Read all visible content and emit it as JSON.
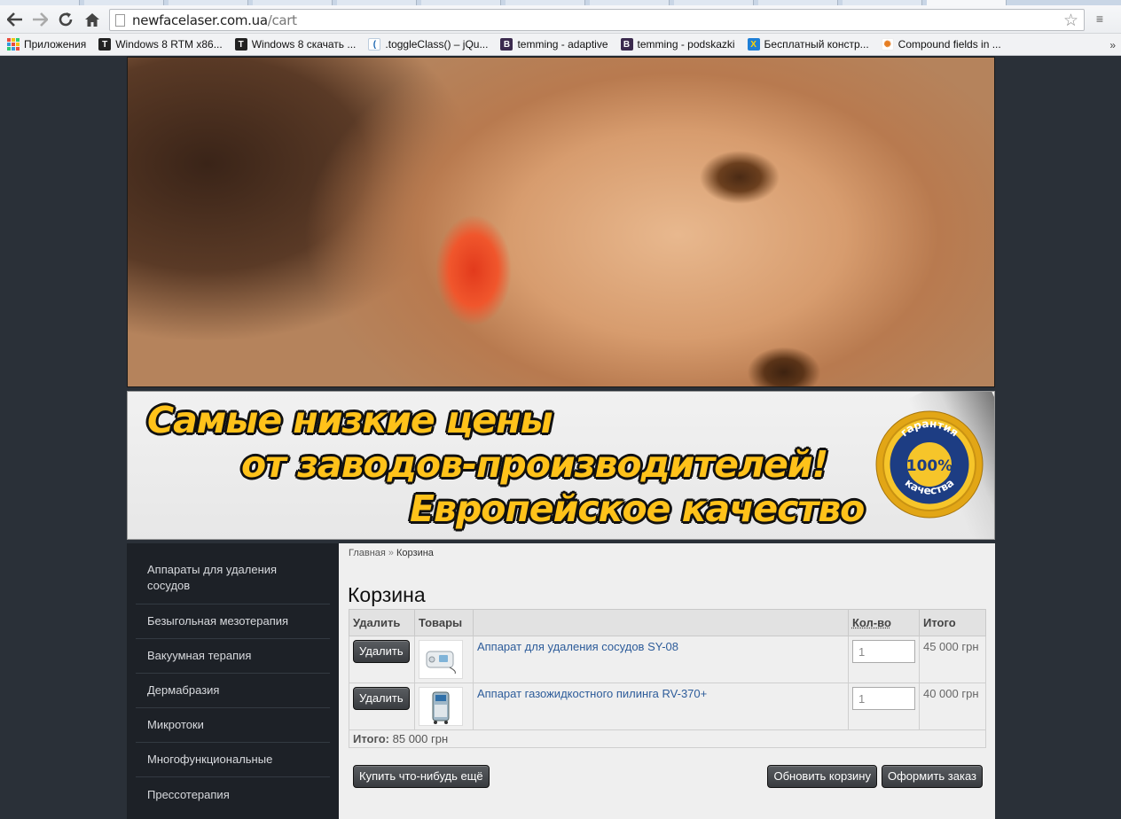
{
  "browser": {
    "url_host": "newfacelaser.com.ua",
    "url_path": "/cart",
    "bookmarks": [
      {
        "label": "Приложения",
        "icon": "apps-grid-icon"
      },
      {
        "label": "Windows 8 RTM x86...",
        "icon": "t-site-icon"
      },
      {
        "label": "Windows 8 скачать ...",
        "icon": "t-site-icon"
      },
      {
        "label": ".toggleClass() – jQu...",
        "icon": "jquery-icon"
      },
      {
        "label": "temming - adaptive",
        "icon": "bootstrap-icon"
      },
      {
        "label": "temming - podskazki",
        "icon": "bootstrap-icon"
      },
      {
        "label": "Бесплатный констр...",
        "icon": "x-site-icon"
      },
      {
        "label": "Compound fields in ...",
        "icon": "drupal-icon"
      }
    ]
  },
  "banner": {
    "line1": "Самые низкие цены",
    "line2": "от заводов-производителей!",
    "line3": "Европейское качество",
    "seal_top": "гарантия",
    "seal_center": "100%",
    "seal_bottom": "качества"
  },
  "sidebar": {
    "items": [
      "Аппараты для удаления сосудов",
      "Безыгольная мезотерапия",
      "Вакуумная терапия",
      "Дермабразия",
      "Микротоки",
      "Многофункциональные",
      "Прессотерапия"
    ]
  },
  "breadcrumb": {
    "home": "Главная",
    "separator": "»",
    "current": "Корзина"
  },
  "cart": {
    "title": "Корзина",
    "columns": {
      "remove": "Удалить",
      "products": "Товары",
      "qty": "Кол-во",
      "total": "Итого"
    },
    "items": [
      {
        "remove_label": "Удалить",
        "name": "Аппарат для удаления сосудов SY-08",
        "qty": "1",
        "price": "45 000 грн"
      },
      {
        "remove_label": "Удалить",
        "name": "Аппарат газожидкостного пилинга RV-370+",
        "qty": "1",
        "price": "40 000 грн"
      }
    ],
    "total_label": "Итого:",
    "total_value": "85 000 грн",
    "buttons": {
      "continue": "Купить что-нибудь ещё",
      "update": "Обновить корзину",
      "checkout": "Оформить заказ"
    }
  }
}
